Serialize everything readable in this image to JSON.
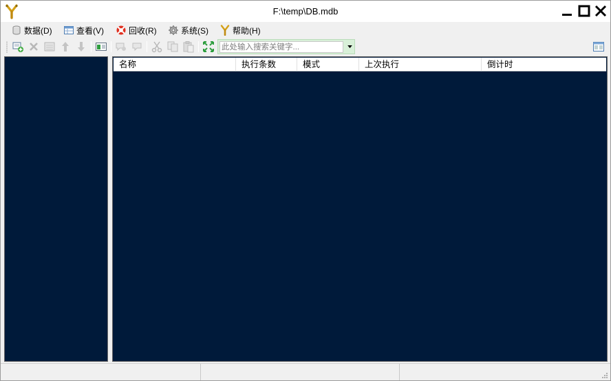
{
  "window": {
    "title": "F:\\temp\\DB.mdb",
    "app_icon": "slingshot-y-icon"
  },
  "menu": {
    "items": [
      {
        "label": "数据(D)",
        "icon": "database-icon"
      },
      {
        "label": "查看(V)",
        "icon": "view-grid-icon"
      },
      {
        "label": "回收(R)",
        "icon": "lifebuoy-icon"
      },
      {
        "label": "系统(S)",
        "icon": "gear-icon"
      },
      {
        "label": "帮助(H)",
        "icon": "slingshot-y-icon"
      }
    ]
  },
  "toolbar": {
    "buttons": [
      "add-item-icon",
      "delete-icon",
      "properties-icon",
      "move-up-icon",
      "move-down-icon",
      "preview-icon",
      "comment-add-icon",
      "comment-icon",
      "cut-icon",
      "copy-icon",
      "paste-icon",
      "expand-icon"
    ],
    "search_placeholder": "此处输入搜索关键字...",
    "search_value": ""
  },
  "list": {
    "columns": [
      "名称",
      "执行条数",
      "模式",
      "上次执行",
      "倒计时"
    ],
    "rows": []
  },
  "statusbar": {
    "panels": [
      "",
      "",
      ""
    ]
  },
  "colors": {
    "pane_background": "#001a3a",
    "chrome": "#f0f0f0",
    "accent_search": "#d8f0d8"
  }
}
